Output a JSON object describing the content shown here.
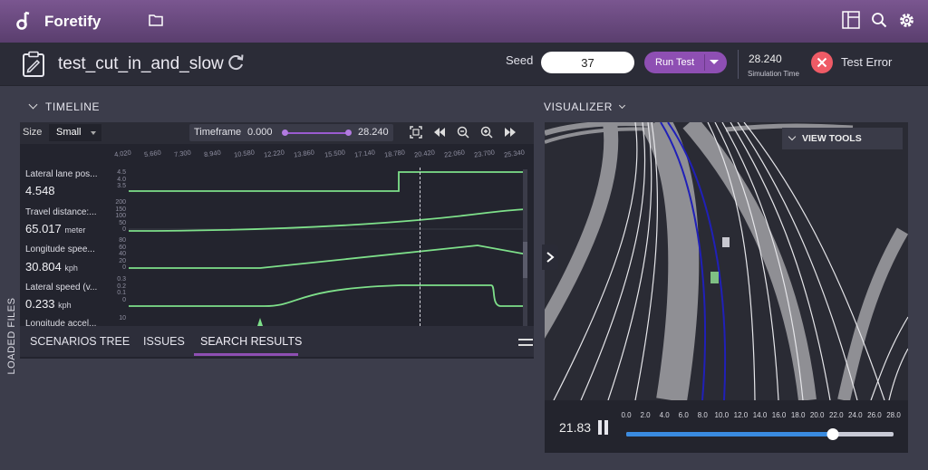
{
  "app": {
    "title": "Foretify"
  },
  "header": {
    "scenario_name": "test_cut_in_and_slow",
    "seed_label": "Seed",
    "seed_value": "37",
    "run_button": "Run Test",
    "sim_time": "28.240",
    "sim_time_label": "Simulation Time",
    "status": "Test Error"
  },
  "side": {
    "label": "LOADED FILES"
  },
  "timeline": {
    "title": "TIMELINE",
    "size_label": "Size",
    "size_value": "Small",
    "timeframe_label": "Timeframe",
    "timeframe_start": "0.000",
    "timeframe_end": "28.240",
    "ticks": [
      "4.020",
      "5.660",
      "7.300",
      "8.940",
      "10.580",
      "12.220",
      "13.860",
      "15.500",
      "17.140",
      "18.780",
      "20.420",
      "22.060",
      "23.700",
      "25.340"
    ],
    "rows": [
      {
        "label": "Lateral lane pos...",
        "value": "4.548",
        "unit": "",
        "y_ticks": [
          "4.5",
          "4.0",
          "3.5"
        ]
      },
      {
        "label": "Travel distance:...",
        "value": "65.017",
        "unit": "meter",
        "y_ticks": [
          "200",
          "150",
          "100",
          "50",
          "0"
        ]
      },
      {
        "label": "Longitude spee...",
        "value": "30.804",
        "unit": "kph",
        "y_ticks": [
          "80",
          "60",
          "40",
          "20",
          "0"
        ]
      },
      {
        "label": "Lateral speed (v...",
        "value": "0.233",
        "unit": "kph",
        "y_ticks": [
          "0.3",
          "0.2",
          "0.1",
          "0"
        ]
      },
      {
        "label": "Longitude accel...",
        "value": "",
        "unit": "",
        "y_ticks": [
          "10"
        ]
      }
    ]
  },
  "tabs": [
    {
      "label": "SCENARIOS TREE"
    },
    {
      "label": "ISSUES"
    },
    {
      "label": "SEARCH RESULTS"
    }
  ],
  "visualizer": {
    "title": "VISUALIZER",
    "view_tools": "VIEW TOOLS",
    "current_time": "21.83",
    "time_ticks": [
      "0.0",
      "2.0",
      "4.0",
      "6.0",
      "8.0",
      "10.0",
      "12.0",
      "14.0",
      "16.0",
      "18.0",
      "20.0",
      "22.0",
      "24.0",
      "26.0",
      "28.0"
    ],
    "progress": 0.773
  },
  "colors": {
    "accent": "#8e4fb3",
    "plot_line": "#7ee08a",
    "error": "#ef5b66",
    "progress": "#3a8be0"
  }
}
